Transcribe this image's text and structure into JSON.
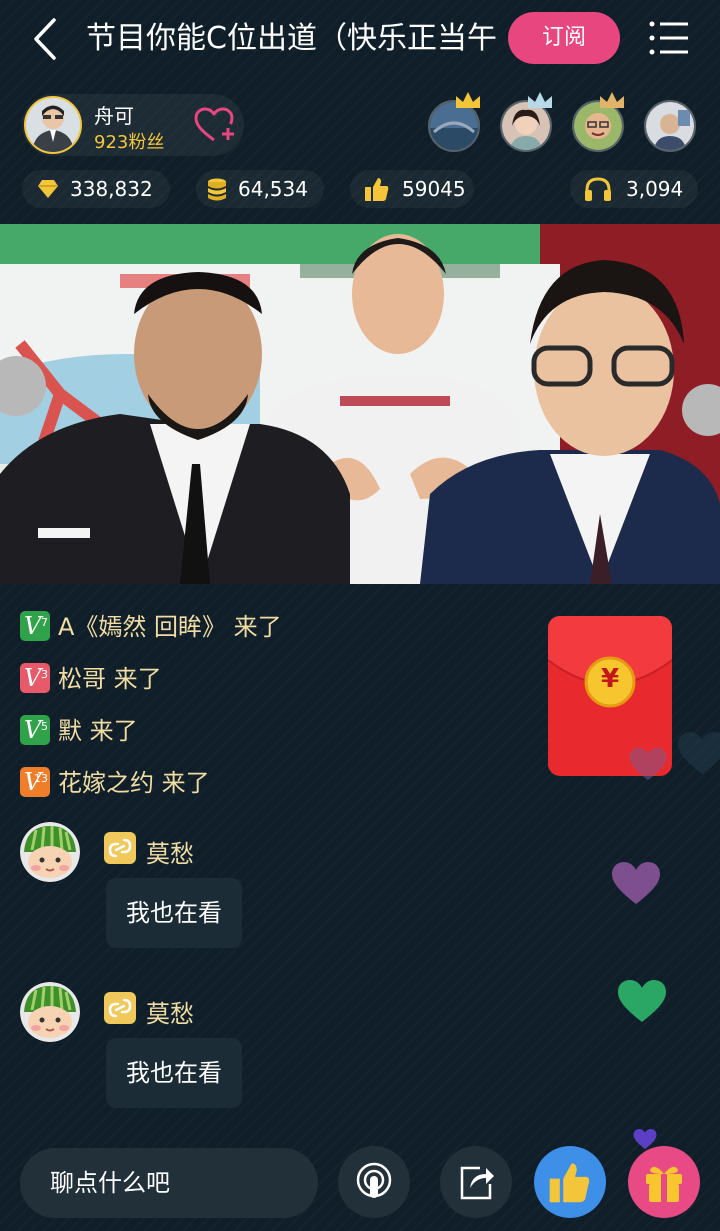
{
  "header": {
    "title": "节目你能C位出道（快乐正当午",
    "subscribe_label": "订阅"
  },
  "host": {
    "name": "舟可",
    "fans": "923粉丝"
  },
  "stats": {
    "diamonds": "338,832",
    "coins": "64,534",
    "likes": "59045",
    "listeners": "3,094"
  },
  "join_messages": [
    {
      "level": "7",
      "color": "#2fa24a",
      "text": "A《嫣然 回眸》 来了"
    },
    {
      "level": "3",
      "color": "#e85a6a",
      "text": "松哥 来了"
    },
    {
      "level": "5",
      "color": "#2fa24a",
      "text": "默 来了"
    },
    {
      "level": "13",
      "color": "#ef7d2a",
      "text": "花嫁之约 来了"
    }
  ],
  "chat": [
    {
      "user": "莫愁",
      "message": "我也在看"
    },
    {
      "user": "莫愁",
      "message": "我也在看"
    }
  ],
  "redpacket": {
    "symbol": "¥"
  },
  "composer": {
    "placeholder": "聊点什么吧"
  },
  "colors": {
    "accent_pink": "#e8467f",
    "gold": "#f2c53a",
    "redpacket": "#e8292e",
    "like_blue": "#3d8fe8",
    "gift_pink": "#e84a86"
  },
  "icons": [
    "back-arrow-icon",
    "menu-icon",
    "heart-plus-icon",
    "diamond-icon",
    "coin-stack-icon",
    "thumbs-up-icon",
    "headphones-icon",
    "mic-icon",
    "share-icon",
    "gift-icon"
  ]
}
